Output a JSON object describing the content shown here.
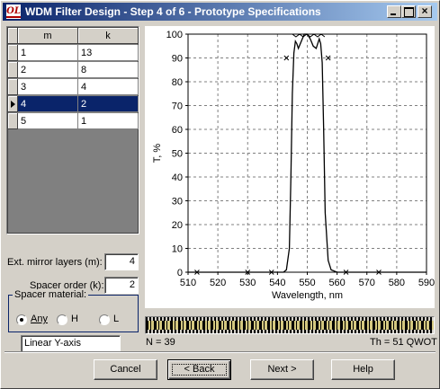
{
  "window": {
    "title": "WDM Filter Design - Step 4 of 6 - Prototype Specifications",
    "icon_text": "OL",
    "controls": [
      "minimize-icon",
      "maximize-icon",
      "close-icon"
    ]
  },
  "table": {
    "columns": [
      "m",
      "k"
    ],
    "rows": [
      {
        "m": "1",
        "k": "13"
      },
      {
        "m": "2",
        "k": "8"
      },
      {
        "m": "3",
        "k": "4"
      },
      {
        "m": "4",
        "k": "2"
      },
      {
        "m": "5",
        "k": "1"
      }
    ],
    "selected_row": 3
  },
  "fields": {
    "ext_mirror_label": "Ext. mirror layers (m):",
    "ext_mirror_value": "4",
    "spacer_order_label": "Spacer order (k):",
    "spacer_order_value": "2"
  },
  "spacer_material": {
    "label": "Spacer material:",
    "options": [
      "Any",
      "H",
      "L"
    ],
    "selected": "Any"
  },
  "axis_mode": "Linear Y-axis",
  "status": {
    "n_label": "N = 39",
    "th_label": "Th = 51 QWOT"
  },
  "buttons": {
    "cancel": "Cancel",
    "back": "< Back",
    "next": "Next >",
    "help": "Help"
  },
  "chart_data": {
    "type": "line",
    "xlabel": "Wavelength, nm",
    "ylabel": "T, %",
    "xlim": [
      510,
      590
    ],
    "ylim": [
      0,
      100
    ],
    "x_ticks": [
      510,
      520,
      530,
      540,
      550,
      560,
      570,
      580,
      590
    ],
    "y_ticks": [
      0,
      10,
      20,
      30,
      40,
      50,
      60,
      70,
      80,
      90,
      100
    ],
    "grid": true,
    "series": [
      {
        "color": "#000000",
        "x": [
          510,
          540,
          542,
          543,
          544,
          544.5,
          545,
          545.5,
          546,
          546.5,
          547,
          548,
          549,
          550,
          551,
          552,
          553,
          553.5,
          554,
          554.5,
          555,
          555.5,
          556,
          557,
          558,
          560,
          590
        ],
        "y": [
          0,
          0,
          0,
          1,
          10,
          40,
          75,
          92,
          97,
          96,
          94,
          97,
          100,
          100,
          98,
          95,
          94,
          96,
          98,
          96,
          88,
          60,
          25,
          5,
          1,
          0,
          0
        ]
      }
    ],
    "markers": [
      {
        "x": 543,
        "y": 90
      },
      {
        "x": 557,
        "y": 90
      },
      {
        "x": 513,
        "y": 0
      },
      {
        "x": 530,
        "y": 0
      },
      {
        "x": 538,
        "y": 0
      },
      {
        "x": 563,
        "y": 0
      },
      {
        "x": 574,
        "y": 0
      }
    ],
    "ripple_band": {
      "from": 545,
      "to": 556,
      "y": 100
    }
  }
}
